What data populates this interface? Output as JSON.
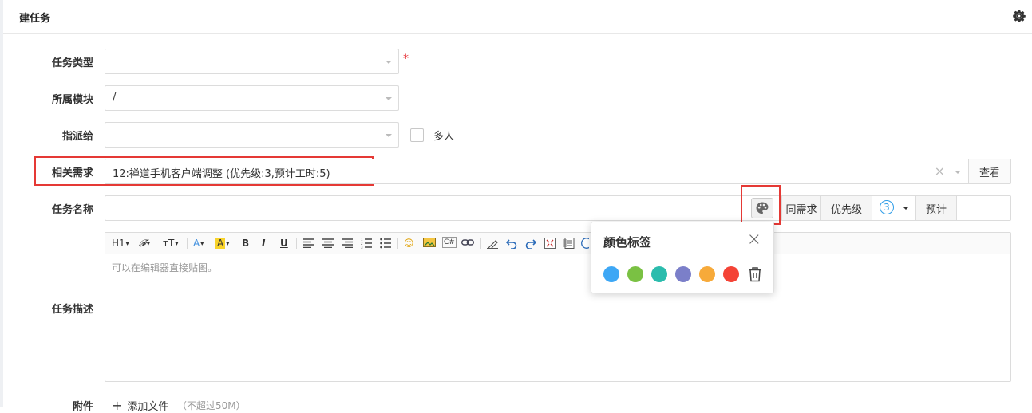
{
  "header": {
    "title": "建任务"
  },
  "form": {
    "task_type": {
      "label": "任务类型",
      "value": "",
      "required_mark": "*"
    },
    "module": {
      "label": "所属模块",
      "value": "/"
    },
    "assign_to": {
      "label": "指派给",
      "value": "",
      "multi_label": "多人"
    },
    "story": {
      "label": "相关需求",
      "value": "12:禅道手机客户端调整 (优先级:3,预计工时:5)",
      "clear_symbol": "×",
      "view_button": "查看"
    },
    "task_name": {
      "label": "任务名称",
      "value": "",
      "same_as_story": "同需求",
      "priority_label": "优先级",
      "priority_value": "3",
      "estimate_label": "预计"
    },
    "description": {
      "label": "任务描述",
      "placeholder": "可以在编辑器直接贴图。",
      "toolbar": [
        "H1",
        "𝓕",
        "тT",
        "A",
        "A",
        "B",
        "I",
        "U",
        "☺",
        "C#"
      ]
    },
    "attachment": {
      "label": "附件",
      "add_file": "添加文件",
      "limit": "（不超过50M）"
    }
  },
  "color_popover": {
    "title": "颜色标签",
    "close_symbol": "×",
    "colors": [
      "#3da7f5",
      "#7ac143",
      "#2bbcad",
      "#7b7fc9",
      "#f7aa3a",
      "#f44336"
    ]
  }
}
